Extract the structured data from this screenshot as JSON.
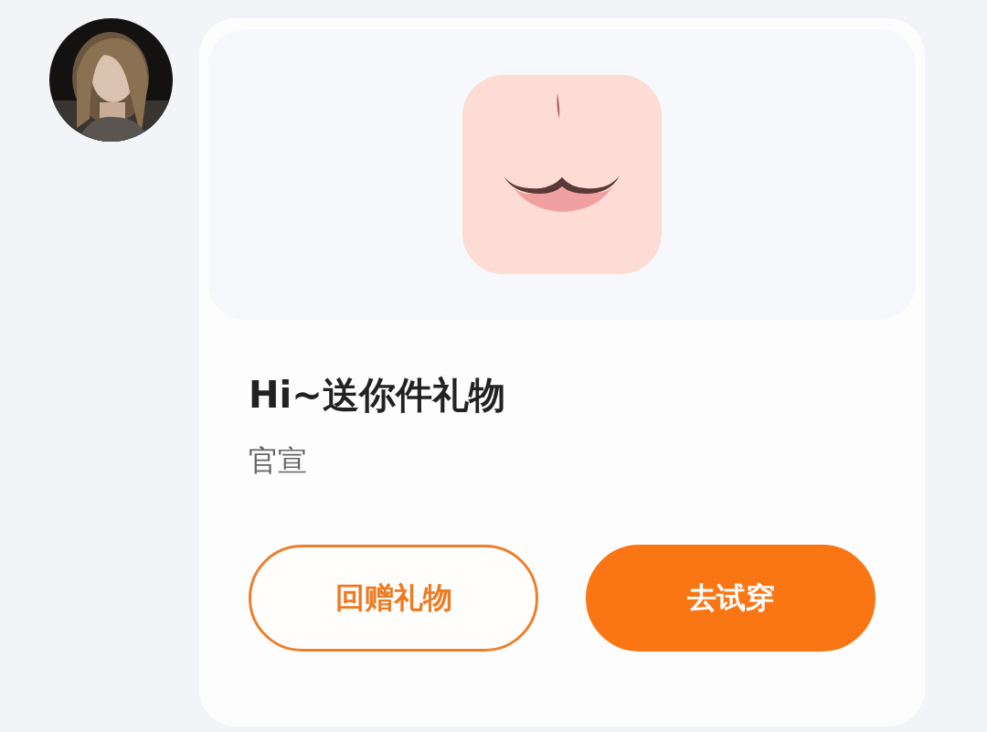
{
  "card": {
    "title": "Hi~送你件礼物",
    "subtitle": "官宣",
    "buttons": [
      {
        "label": "回赠礼物",
        "kind": "outline"
      },
      {
        "label": "去试穿",
        "kind": "filled"
      }
    ]
  }
}
